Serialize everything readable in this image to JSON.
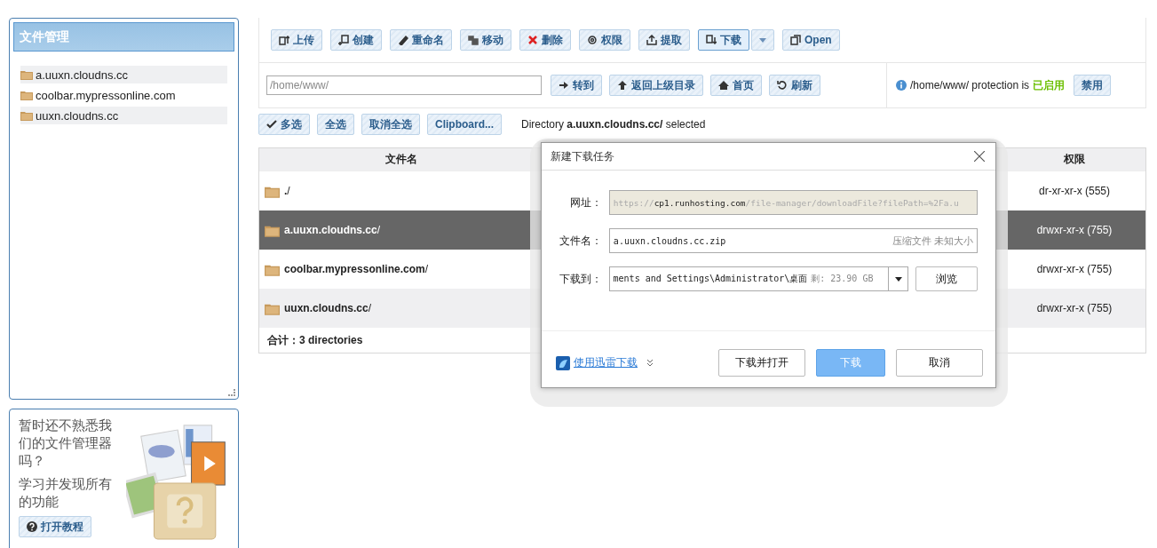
{
  "sidebar": {
    "title": "文件管理",
    "items": [
      {
        "label": "a.uuxn.cloudns.cc"
      },
      {
        "label": "coolbar.mypressonline.com"
      },
      {
        "label": "uuxn.cloudns.cc"
      }
    ]
  },
  "help": {
    "question": "暂时还不熟悉我们的文件管理器吗？",
    "hint": "学习并发现所有的功能",
    "button": "打开教程"
  },
  "toolbar": [
    {
      "label": "上传"
    },
    {
      "label": "创建"
    },
    {
      "label": "重命名"
    },
    {
      "label": "移动"
    },
    {
      "label": "删除"
    },
    {
      "label": "权限"
    },
    {
      "label": "提取"
    },
    {
      "label": "下载"
    },
    {
      "label": "Open"
    }
  ],
  "path": {
    "value": "/home/www/",
    "buttons": [
      {
        "label": "转到"
      },
      {
        "label": "返回上级目录"
      },
      {
        "label": "首页"
      },
      {
        "label": "刷新"
      }
    ]
  },
  "protection": {
    "text": "/home/www/ protection is",
    "status": "已启用",
    "button": "禁用"
  },
  "select_buttons": [
    {
      "label": "多选"
    },
    {
      "label": "全选"
    },
    {
      "label": "取消全选"
    },
    {
      "label": "Clipboard..."
    }
  ],
  "selection_status": "Directory **a.uuxn.cloudns.cc/** selected",
  "table": {
    "columns": [
      "文件名",
      "权限"
    ],
    "rows": [
      {
        "name": "**.**/",
        "permissions": "dr-xr-xr-x (555)",
        "selected": false
      },
      {
        "name": "**a.uuxn.cloudns.cc**/",
        "permissions": "drwxr-xr-x (755)",
        "selected": true
      },
      {
        "name": "**coolbar.mypressonline.com**/",
        "permissions": "drwxr-xr-x (755)",
        "selected": false
      },
      {
        "name": "**uuxn.cloudns.cc**/",
        "permissions": "drwxr-xr-x (755)",
        "selected": false
      }
    ],
    "total": "合计：3 directories"
  },
  "dialog": {
    "title": "新建下载任务",
    "url_label": "网址：",
    "url": {
      "scheme": "https://",
      "host": "cp1.runhosting.com",
      "path": "/file-manager/downloadFile?filePath=%2Fa.u"
    },
    "filename_label": "文件名：",
    "filename": "a.uuxn.cloudns.cc.zip",
    "file_info": "压缩文件 未知大小",
    "dest_label": "下载到：",
    "dest": "ments and Settings\\Administrator\\桌面",
    "free_space": "剩: 23.90 GB",
    "browse": "浏览",
    "thunder_link": "使用迅雷下载",
    "buttons": [
      {
        "label": "下载并打开",
        "kind": "normal"
      },
      {
        "label": "下载",
        "kind": "primary"
      },
      {
        "label": "取消",
        "kind": "normal"
      }
    ]
  }
}
